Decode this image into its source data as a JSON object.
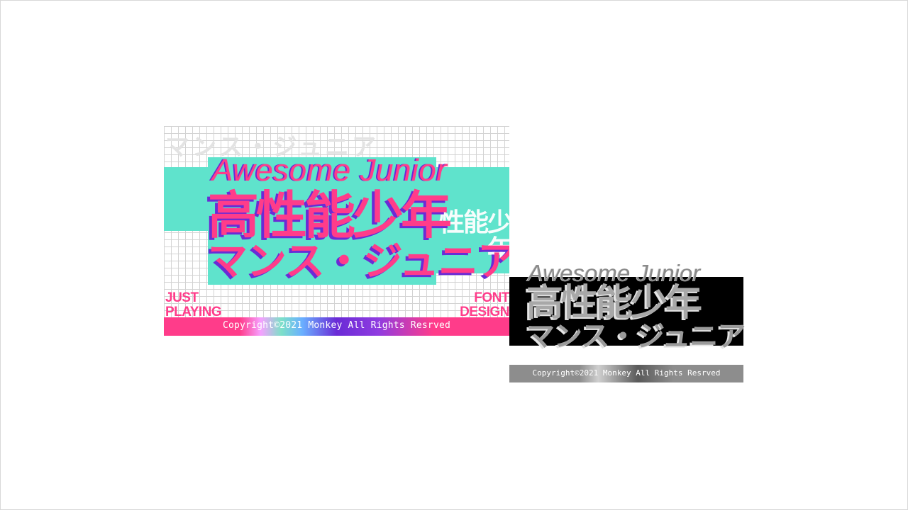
{
  "colors": {
    "pink": "#ff3c8a",
    "teal": "#5fe3cc",
    "purple": "#6a2bd6",
    "black": "#000000",
    "gray": "#8d8d8d"
  },
  "color_card": {
    "ghost_kana": "マンス・ジュニア",
    "ghost_kanji": "性能少年",
    "english_title": "Awesome Junior",
    "kanji_title": "高性能少年",
    "kana_title": "マンス・ジュニア",
    "left_caption": [
      "JUST",
      "PLAYING"
    ],
    "right_caption": [
      "FONT",
      "DESIGN"
    ],
    "copyright": "Copyright©2021 Monkey All Rights Resrved"
  },
  "mono_card": {
    "english_title": "Awesome Junior",
    "kanji_title": "高性能少年",
    "kana_title": "マンス・ジュニア",
    "copyright": "Copyright©2021 Monkey All Rights Resrved"
  }
}
